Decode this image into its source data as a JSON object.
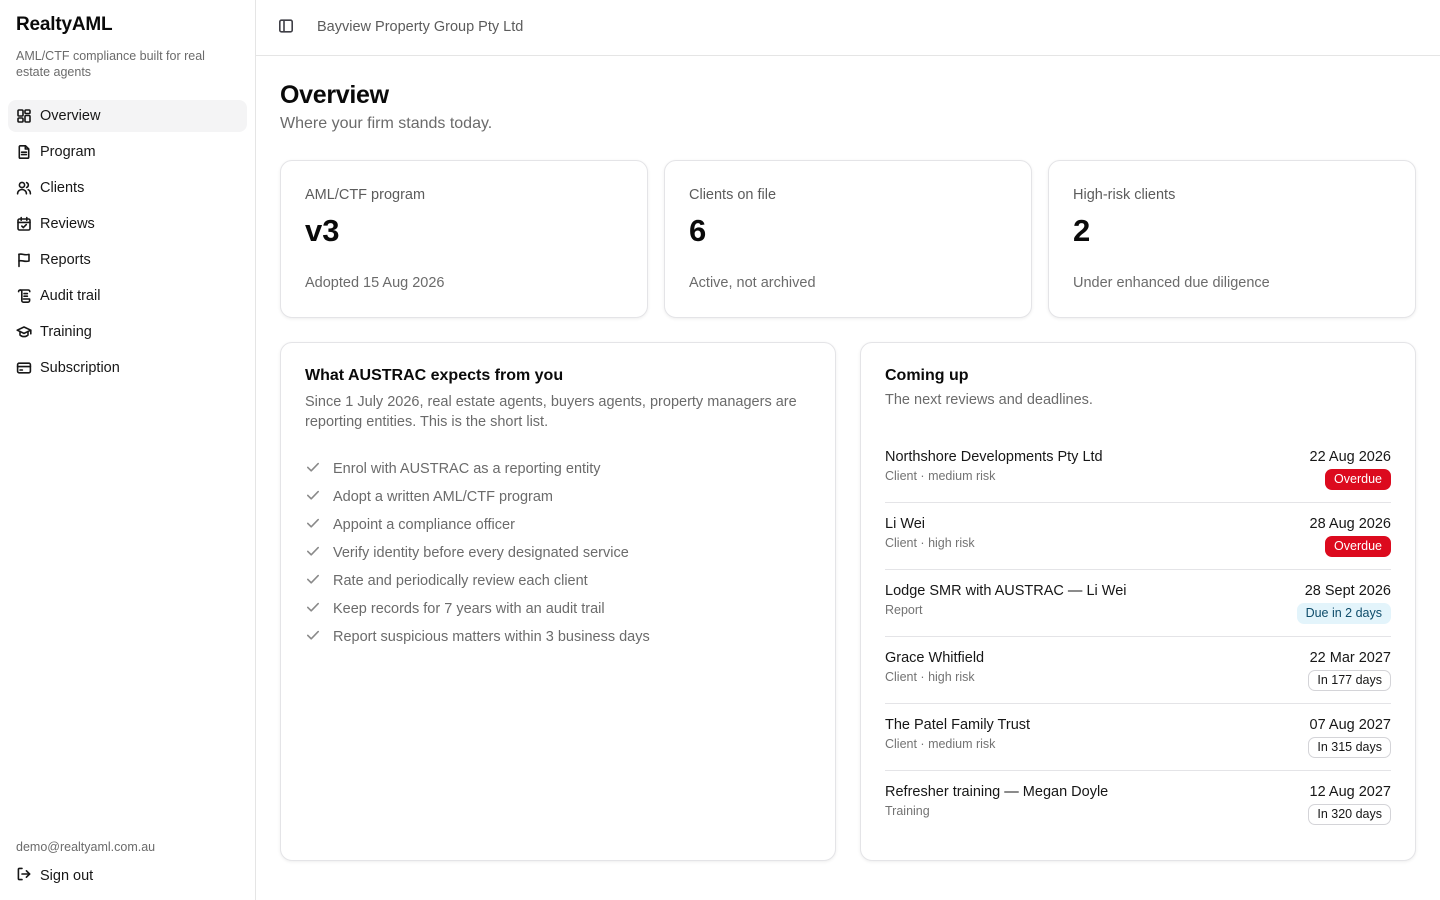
{
  "app": {
    "name": "RealtyAML",
    "tagline": "AML/CTF compliance built for real estate agents"
  },
  "sidebar": {
    "items": [
      {
        "label": "Overview",
        "icon": "layout-dashboard-icon",
        "active": true
      },
      {
        "label": "Program",
        "icon": "document-icon",
        "active": false
      },
      {
        "label": "Clients",
        "icon": "users-icon",
        "active": false
      },
      {
        "label": "Reviews",
        "icon": "calendar-check-icon",
        "active": false
      },
      {
        "label": "Reports",
        "icon": "flag-icon",
        "active": false
      },
      {
        "label": "Audit trail",
        "icon": "scroll-icon",
        "active": false
      },
      {
        "label": "Training",
        "icon": "graduation-cap-icon",
        "active": false
      },
      {
        "label": "Subscription",
        "icon": "credit-card-icon",
        "active": false
      }
    ],
    "user_email": "demo@realtyaml.com.au",
    "sign_out_label": "Sign out"
  },
  "topbar": {
    "organization": "Bayview Property Group Pty Ltd"
  },
  "page": {
    "title": "Overview",
    "subtitle": "Where your firm stands today."
  },
  "stats": [
    {
      "label": "AML/CTF program",
      "value": "v3",
      "note": "Adopted 15 Aug 2026"
    },
    {
      "label": "Clients on file",
      "value": "6",
      "note": "Active, not archived"
    },
    {
      "label": "High-risk clients",
      "value": "2",
      "note": "Under enhanced due diligence"
    }
  ],
  "expectations": {
    "title": "What AUSTRAC expects from you",
    "description": "Since 1 July 2026, real estate agents, buyers agents, property managers are reporting entities. This is the short list.",
    "items": [
      "Enrol with AUSTRAC as a reporting entity",
      "Adopt a written AML/CTF program",
      "Appoint a compliance officer",
      "Verify identity before every designated service",
      "Rate and periodically review each client",
      "Keep records for 7 years with an audit trail",
      "Report suspicious matters within 3 business days"
    ]
  },
  "upcoming": {
    "title": "Coming up",
    "description": "The next reviews and deadlines.",
    "events": [
      {
        "title": "Northshore Developments Pty Ltd",
        "meta": "Client · medium risk",
        "date": "22 Aug 2026",
        "badge": "Overdue",
        "status": "overdue"
      },
      {
        "title": "Li Wei",
        "meta": "Client · high risk",
        "date": "28 Aug 2026",
        "badge": "Overdue",
        "status": "overdue"
      },
      {
        "title": "Lodge SMR with AUSTRAC — Li Wei",
        "meta": "Report",
        "date": "28 Sept 2026",
        "badge": "Due in 2 days",
        "status": "soon"
      },
      {
        "title": "Grace Whitfield",
        "meta": "Client · high risk",
        "date": "22 Mar 2027",
        "badge": "In 177 days",
        "status": "later"
      },
      {
        "title": "The Patel Family Trust",
        "meta": "Client · medium risk",
        "date": "07 Aug 2027",
        "badge": "In 315 days",
        "status": "later"
      },
      {
        "title": "Refresher training — Megan Doyle",
        "meta": "Training",
        "date": "12 Aug 2027",
        "badge": "In 320 days",
        "status": "later"
      }
    ]
  },
  "colors": {
    "overdue": "#dc0a1e",
    "soon_bg": "#e3f4fb",
    "active_nav_bg": "#f4f4f5",
    "border": "#e4e4e7"
  }
}
